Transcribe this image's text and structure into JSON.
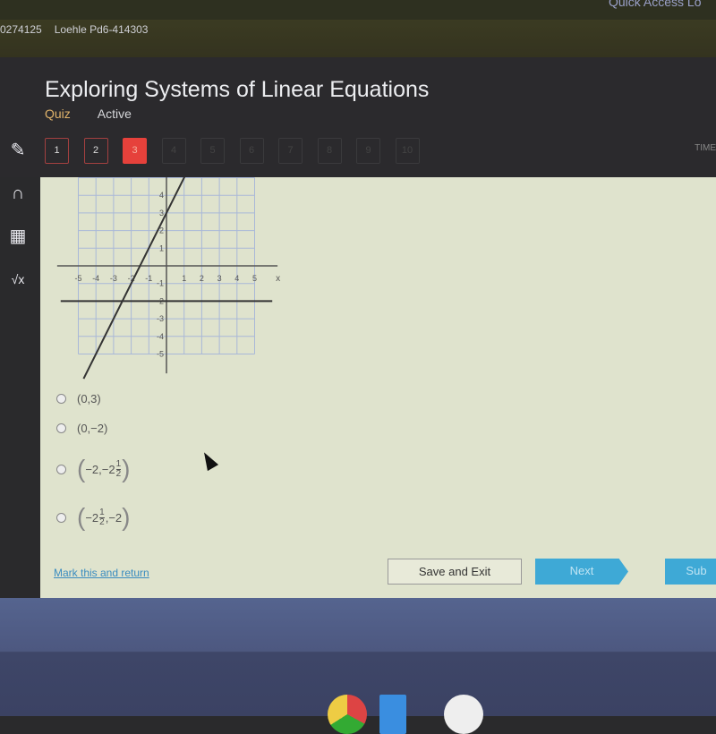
{
  "topbar": {
    "item1": "Quick Access Lo"
  },
  "breadcrumb": {
    "id": "0274125",
    "class": "Loehle Pd6-414303"
  },
  "header": {
    "title": "Exploring Systems of Linear Equations",
    "type": "Quiz",
    "status": "Active",
    "timer_label": "TIME"
  },
  "questions": [
    {
      "n": "1",
      "state": "done"
    },
    {
      "n": "2",
      "state": "done"
    },
    {
      "n": "3",
      "state": "current"
    },
    {
      "n": "4"
    },
    {
      "n": "5"
    },
    {
      "n": "6"
    },
    {
      "n": "7"
    },
    {
      "n": "8"
    },
    {
      "n": "9"
    },
    {
      "n": "10"
    }
  ],
  "tools": [
    "pencil-icon",
    "headphones-icon",
    "calculator-icon",
    "sqrt-icon"
  ],
  "chart_data": {
    "type": "line",
    "xlabel": "x",
    "xlim": [
      -5,
      5
    ],
    "ylim": [
      -5,
      5
    ],
    "grid": true,
    "x_ticks": [
      "-5",
      "-4",
      "-3",
      "-2",
      "-1",
      "1",
      "2",
      "3",
      "4",
      "5"
    ],
    "y_ticks": [
      "4",
      "3",
      "2",
      "1",
      "-1",
      "-2",
      "-3",
      "-4",
      "-5"
    ],
    "series": [
      {
        "equation": "y = 2x + 3",
        "points": [
          [
            -4.7,
            -6.4
          ],
          [
            1.2,
            5.4
          ]
        ]
      },
      {
        "equation": "y = -2",
        "points": [
          [
            -6,
            -2
          ],
          [
            6,
            -2
          ]
        ]
      }
    ]
  },
  "options": [
    {
      "text": "(0,3)"
    },
    {
      "text": "(0,−2)"
    },
    {
      "pre": "−2,−2",
      "num": "1",
      "den": "2",
      "post": ""
    },
    {
      "pre": "−2",
      "num": "1",
      "den": "2",
      "post": ",−2"
    }
  ],
  "footer": {
    "mark": "Mark this and return",
    "save": "Save and Exit",
    "next": "Next",
    "submit": "Sub"
  }
}
